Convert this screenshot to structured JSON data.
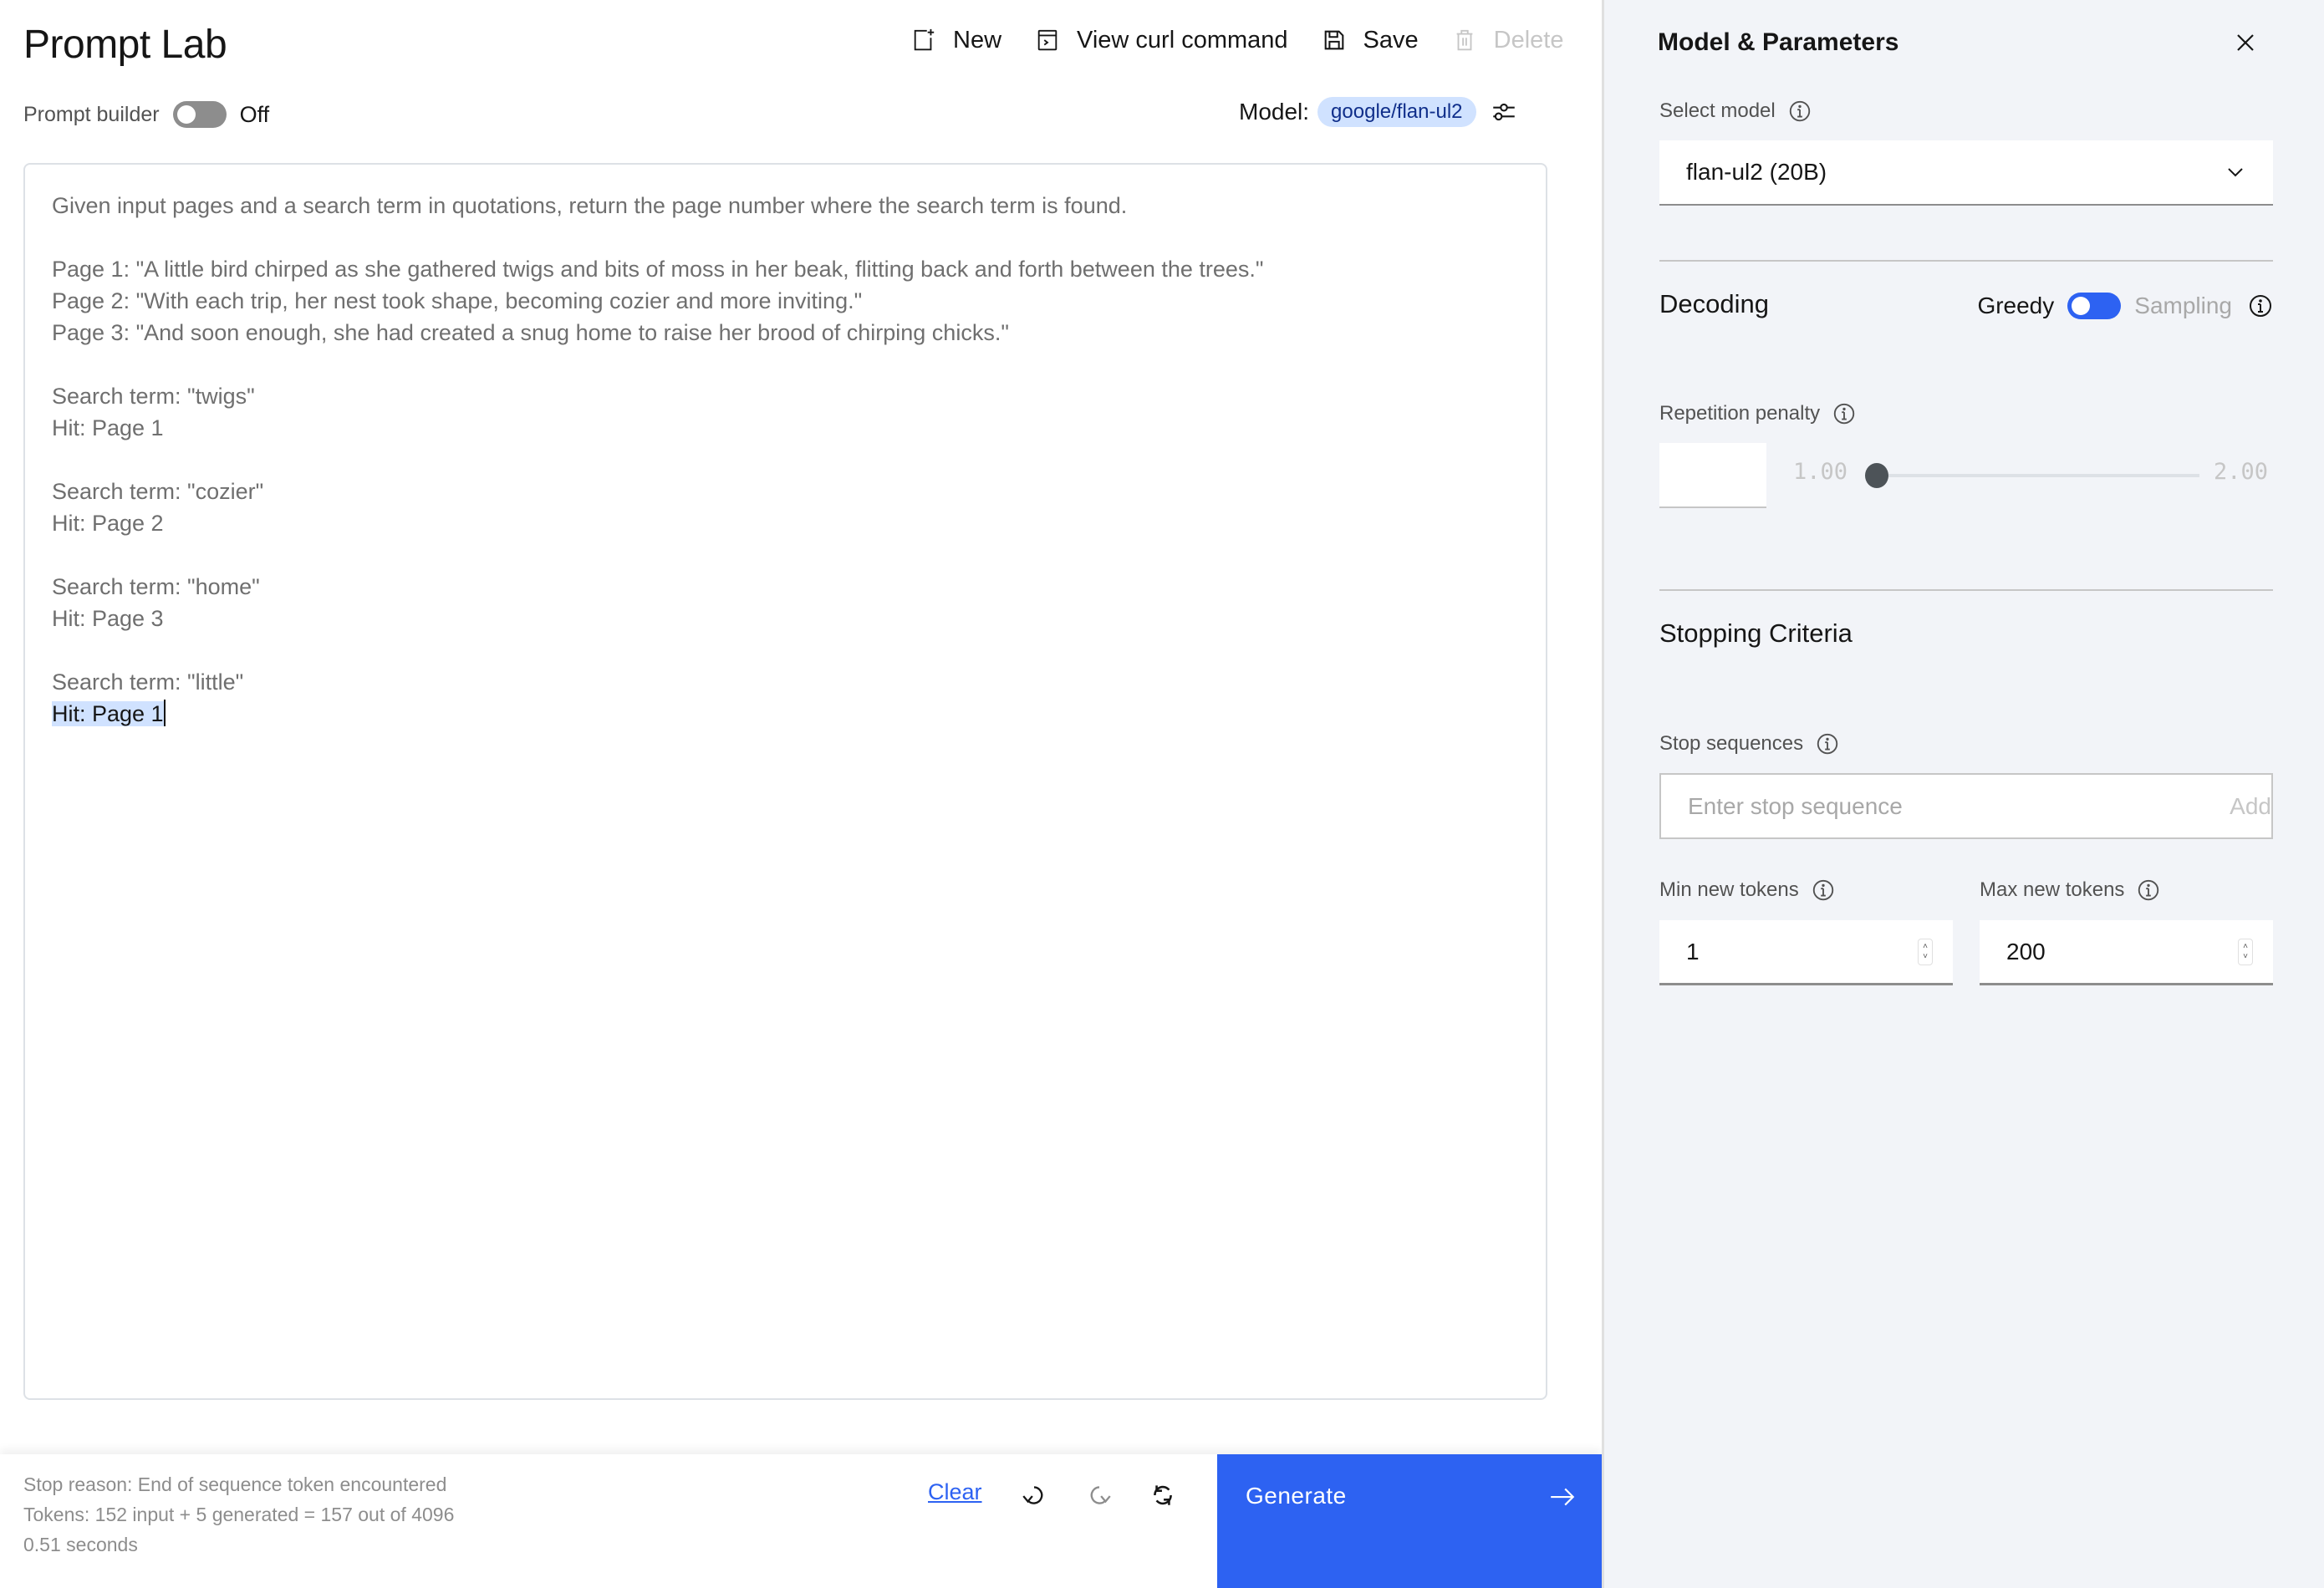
{
  "header": {
    "title": "Prompt Lab",
    "prompt_builder_label": "Prompt builder",
    "prompt_builder_state": "Off",
    "prompt_builder_on": false
  },
  "toolbar": {
    "new_label": "New",
    "curl_label": "View curl command",
    "save_label": "Save",
    "delete_label": "Delete",
    "delete_disabled": true
  },
  "model": {
    "label": "Model:",
    "chip": "google/flan-ul2"
  },
  "editor": {
    "lines": [
      "Given input pages and a search term in quotations, return the page number where the search term is found.",
      "",
      "Page 1: \"A little bird chirped as she gathered twigs and bits of moss in her beak, flitting back and forth between the trees.\"",
      "Page 2: \"With each trip, her nest took shape, becoming cozier and more inviting.\"",
      "Page 3: \"And soon enough, she had created a snug home to raise her brood of chirping chicks.\"",
      "",
      "Search term: \"twigs\"",
      "Hit: Page 1",
      "",
      "Search term: \"cozier\"",
      "Hit: Page 2",
      "",
      "Search term: \"home\"",
      "Hit: Page 3",
      "",
      "Search term: \"little\""
    ],
    "generated": "Hit: Page 1"
  },
  "footer": {
    "stop_reason": "Stop reason: End of sequence token encountered",
    "tokens": "Tokens: 152 input + 5 generated = 157 out of 4096",
    "duration": "0.51 seconds",
    "clear_label": "Clear",
    "generate_label": "Generate"
  },
  "panel": {
    "title": "Model & Parameters",
    "select_model_label": "Select model",
    "selected_model": "flan-ul2 (20B)",
    "decoding": {
      "title": "Decoding",
      "option_left": "Greedy",
      "option_right": "Sampling",
      "selected": "Greedy"
    },
    "repetition_penalty": {
      "label": "Repetition penalty",
      "value": "",
      "min_label": "1.00",
      "max_label": "2.00",
      "min": 1.0,
      "max": 2.0,
      "current": 1.0
    },
    "stopping": {
      "title": "Stopping Criteria",
      "stop_sequences_label": "Stop sequences",
      "stop_placeholder": "Enter stop sequence",
      "add_label": "Add",
      "min_tokens_label": "Min new tokens",
      "min_tokens_value": "1",
      "max_tokens_label": "Max new tokens",
      "max_tokens_value": "200"
    }
  },
  "colors": {
    "accent": "#2d62f2",
    "chip_bg": "#d0e2ff",
    "panel_bg": "#f2f4f8"
  }
}
